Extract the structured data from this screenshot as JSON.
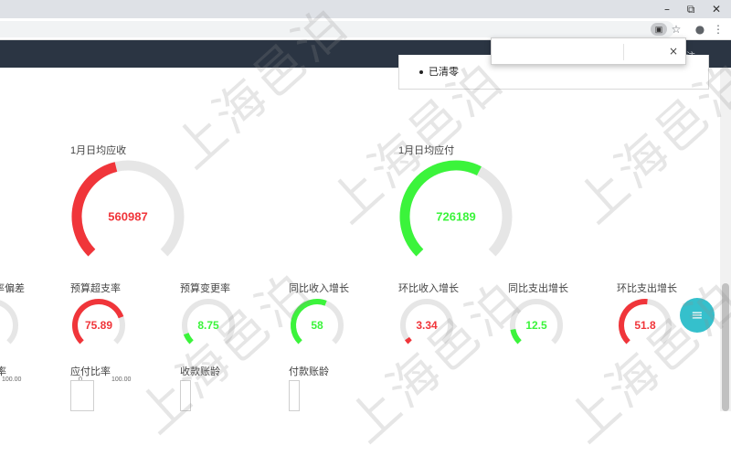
{
  "browser": {
    "window_controls": {
      "minimize": "–",
      "restore": "⧉",
      "close": "✕"
    },
    "toolbar_icons": [
      "page-info-icon",
      "star-icon",
      "account-icon",
      "more-icon"
    ]
  },
  "navbar": {
    "user_text": "注 ⌄"
  },
  "popup": {
    "close_label": "×"
  },
  "legend_box": {
    "item": "已清零"
  },
  "big_gauges": [
    {
      "label": "1月日均应收",
      "value": "560987",
      "fraction": 0.45,
      "color": "#f0353a"
    },
    {
      "label": "1月日均应付",
      "value": "726189",
      "fraction": 0.6,
      "color": "#3bf43b"
    }
  ],
  "small_gauges": [
    {
      "label": "率偏差",
      "value": "",
      "fraction": 0.0,
      "color": "#f0353a"
    },
    {
      "label": "预算超支率",
      "value": "75.89",
      "fraction": 0.76,
      "color": "#f0353a"
    },
    {
      "label": "预算变更率",
      "value": "8.75",
      "fraction": 0.09,
      "color": "#3bf43b"
    },
    {
      "label": "同比收入增长",
      "value": "58",
      "fraction": 0.58,
      "color": "#3bf43b"
    },
    {
      "label": "环比收入增长",
      "value": "3.34",
      "fraction": 0.04,
      "color": "#f0353a"
    },
    {
      "label": "同比支出增长",
      "value": "12.5",
      "fraction": 0.13,
      "color": "#3bf43b"
    },
    {
      "label": "环比支出增长",
      "value": "51.8",
      "fraction": 0.52,
      "color": "#f0353a"
    }
  ],
  "bottom_row": {
    "left_partial": "率",
    "left_tick": "100.00",
    "items": [
      {
        "label": "应付比率",
        "tick_left": "0",
        "tick_right": "100.00"
      },
      {
        "label": "收款账龄"
      },
      {
        "label": "付款账龄"
      }
    ]
  },
  "fab": {
    "icon": "≡"
  },
  "watermark": {
    "text": "上海邑泊"
  }
}
